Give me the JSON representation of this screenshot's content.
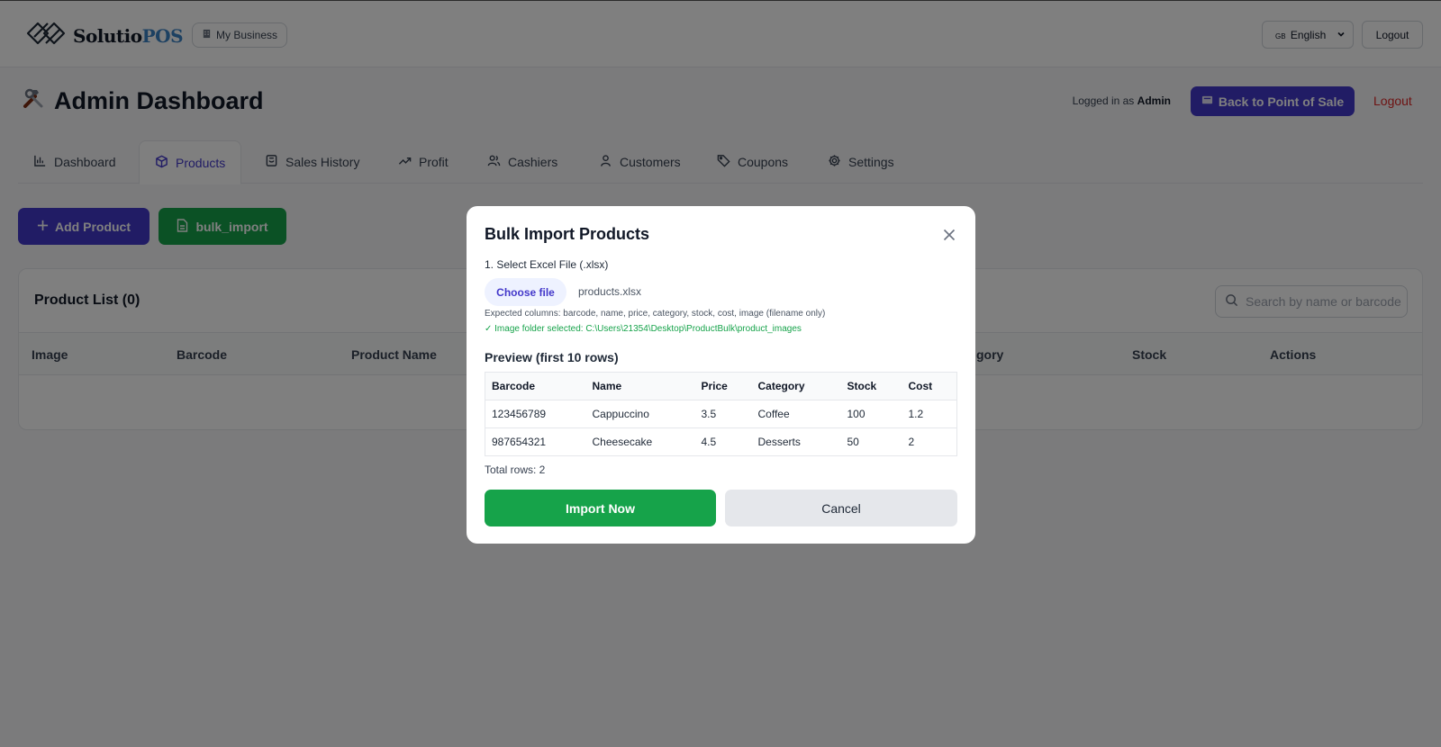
{
  "topbar": {
    "logo": {
      "text_main": "Solutio",
      "text_accent": "POS",
      "icon": "solutiopos-logo-icon"
    },
    "business_button": {
      "icon": "building-icon",
      "label": "My Business"
    },
    "language": {
      "flag": "GB",
      "selected": "English",
      "icon": "chevron-down-icon"
    },
    "logout_label": "Logout"
  },
  "header": {
    "icon": "tools-icon",
    "title": "Admin Dashboard",
    "logged_in_prefix": "Logged in as",
    "logged_in_user": "Admin",
    "back_to_pos": {
      "icon": "cart-icon",
      "label": "Back to Point of Sale"
    },
    "logout_label": "Logout"
  },
  "tabs": [
    {
      "label": "Dashboard",
      "icon": "bar-chart-icon",
      "active": false
    },
    {
      "label": "Products",
      "icon": "package-icon",
      "active": true
    },
    {
      "label": "Sales History",
      "icon": "receipt-icon",
      "active": false
    },
    {
      "label": "Profit",
      "icon": "trending-up-icon",
      "active": false
    },
    {
      "label": "Cashiers",
      "icon": "users-icon",
      "active": false
    },
    {
      "label": "Customers",
      "icon": "user-icon",
      "active": false
    },
    {
      "label": "Coupons",
      "icon": "tag-icon",
      "active": false
    },
    {
      "label": "Settings",
      "icon": "gear-icon",
      "active": false
    }
  ],
  "actions": {
    "add_product": {
      "icon": "plus-icon",
      "label": "Add Product"
    },
    "bulk_import": {
      "icon": "file-icon",
      "label": "bulk_import"
    }
  },
  "product_list": {
    "title": "Product List (0)",
    "search_placeholder": "Search by name or barcode",
    "columns": [
      "Image",
      "Barcode",
      "Product Name",
      "gory",
      "Stock",
      "Actions"
    ]
  },
  "modal": {
    "title": "Bulk Import Products",
    "step_label": "1. Select Excel File (.xlsx)",
    "choose_file_label": "Choose file",
    "file_name": "products.xlsx",
    "expected_columns": "Expected columns: barcode, name, price, category, stock, cost, image (filename only)",
    "folder_selected": "✓ Image folder selected: C:\\Users\\21354\\Desktop\\ProductBulk\\product_images",
    "preview_title": "Preview (first 10 rows)",
    "preview_columns": [
      "Barcode",
      "Name",
      "Price",
      "Category",
      "Stock",
      "Cost"
    ],
    "preview_rows": [
      [
        "123456789",
        "Cappuccino",
        "3.5",
        "Coffee",
        "100",
        "1.2"
      ],
      [
        "987654321",
        "Cheesecake",
        "4.5",
        "Desserts",
        "50",
        "2"
      ]
    ],
    "total_rows": "Total rows: 2",
    "import_label": "Import Now",
    "cancel_label": "Cancel"
  },
  "colors": {
    "primary": "#4338ca",
    "success": "#16a34a",
    "danger": "#dc2626",
    "overlay": "rgba(0,0,0,0.5)"
  }
}
